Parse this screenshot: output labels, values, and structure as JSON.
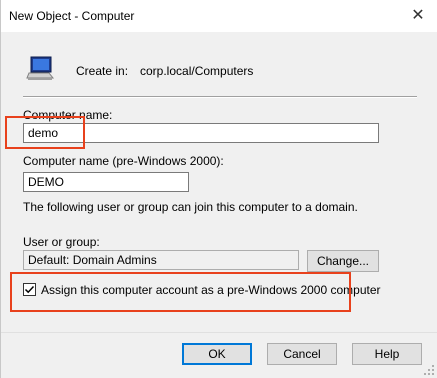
{
  "window": {
    "title": "New Object - Computer",
    "close_glyph": "✕"
  },
  "create_in": {
    "label": "Create in:",
    "value": "corp.local/Computers"
  },
  "computer_name": {
    "label": "Computer name:",
    "value": "demo"
  },
  "pre2000_name": {
    "label": "Computer name (pre-Windows 2000):",
    "value": "DEMO"
  },
  "join_info": "The following user or group can join this computer to a domain.",
  "user_group": {
    "label": "User or group:",
    "value": "Default: Domain Admins",
    "change_label": "Change..."
  },
  "assign_checkbox": {
    "label": "Assign this computer account as a pre-Windows 2000 computer",
    "checked": true
  },
  "buttons": {
    "ok": "OK",
    "cancel": "Cancel",
    "help": "Help"
  },
  "colors": {
    "highlight": "#e8411c",
    "accent": "#0078d7"
  }
}
